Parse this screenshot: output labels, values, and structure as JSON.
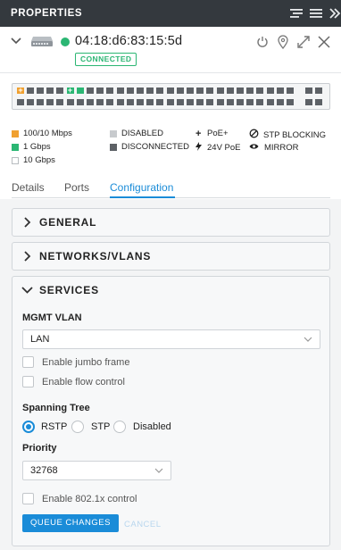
{
  "titlebar": {
    "title": "PROPERTIES",
    "icons": [
      "list-view-icon",
      "menu-icon",
      "collapse-panel-icon"
    ]
  },
  "device": {
    "mac": "04:18:d6:83:15:5d",
    "status": "CONNECTED",
    "status_color": "#2bb673",
    "icons": [
      "chevron-down-icon",
      "switch-device-icon",
      "restart-icon",
      "locate-icon",
      "expand-icon",
      "close-icon"
    ]
  },
  "ports": {
    "top_row": [
      "orange-poe",
      "dark",
      "dark",
      "dark",
      "dark",
      "green-poe",
      "green",
      "dark",
      "dark",
      "dark",
      "dark",
      "dark",
      "dark",
      "dark",
      "dark",
      "dark",
      "dark",
      "dark",
      "dark",
      "dark",
      "dark",
      "dark",
      "dark",
      "dark",
      "dark",
      "dark",
      "dark",
      "dark"
    ],
    "bottom_row": [
      "dark",
      "dark",
      "dark",
      "dark",
      "dark",
      "dark",
      "dark",
      "dark",
      "dark",
      "dark",
      "dark",
      "dark",
      "dark",
      "dark",
      "dark",
      "dark",
      "dark",
      "dark",
      "dark",
      "dark",
      "dark",
      "dark",
      "dark",
      "dark",
      "dark",
      "dark",
      "dark",
      "dark"
    ],
    "sfp_top": [
      "dark",
      "dark"
    ],
    "sfp_bottom": [
      "dark",
      "dark"
    ]
  },
  "legend": {
    "speed_100_10": "100/10 Mbps",
    "speed_1g": "1 Gbps",
    "speed_10g": "10 Gbps",
    "disabled": "DISABLED",
    "disconnected": "DISCONNECTED",
    "poe_plus": "PoE+",
    "poe_24v": "24V PoE",
    "stp_blocking": "STP BLOCKING",
    "mirror": "MIRROR",
    "colors": {
      "speed_100_10": "#f0a030",
      "speed_1g": "#2bb673",
      "disabled": "#c7cacd",
      "disconnected": "#5d6166"
    }
  },
  "tabs": {
    "details": "Details",
    "ports": "Ports",
    "configuration": "Configuration",
    "active": "configuration"
  },
  "sections": {
    "general": "GENERAL",
    "networks": "NETWORKS/VLANS",
    "services": "SERVICES"
  },
  "services": {
    "mgmt_vlan_label": "MGMT VLAN",
    "mgmt_vlan_value": "LAN",
    "jumbo_label": "Enable jumbo frame",
    "flow_label": "Enable flow control",
    "stp_label": "Spanning Tree",
    "stp_options": [
      "RSTP",
      "STP",
      "Disabled"
    ],
    "stp_selected": "RSTP",
    "priority_label": "Priority",
    "priority_value": "32768",
    "dot1x_label": "Enable 802.1x control",
    "queue_button": "QUEUE CHANGES",
    "cancel_button": "CANCEL"
  },
  "accent_color": "#1a8cd8"
}
